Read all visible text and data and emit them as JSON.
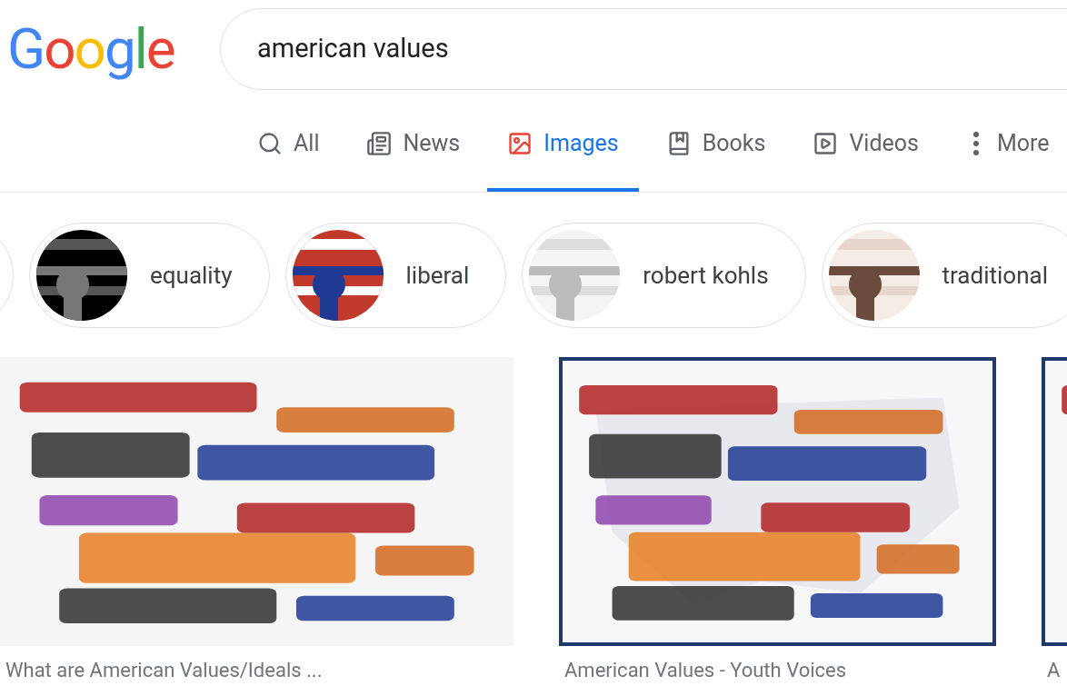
{
  "logo": {
    "text": "Google"
  },
  "search": {
    "value": "american values"
  },
  "tabs": [
    {
      "label": "All",
      "kind": "search",
      "selected": false
    },
    {
      "label": "News",
      "kind": "news",
      "selected": false
    },
    {
      "label": "Images",
      "kind": "images",
      "selected": true
    },
    {
      "label": "Books",
      "kind": "books",
      "selected": false
    },
    {
      "label": "Videos",
      "kind": "videos",
      "selected": false
    },
    {
      "label": "More",
      "kind": "more",
      "selected": false
    }
  ],
  "chips": [
    {
      "label": "equality"
    },
    {
      "label": "liberal"
    },
    {
      "label": "robert kohls"
    },
    {
      "label": "traditional"
    }
  ],
  "results": [
    {
      "caption": "What are American Values/Ideals ...",
      "kind": "plain"
    },
    {
      "caption": "American Values - Youth Voices",
      "kind": "framed"
    },
    {
      "caption": "A",
      "kind": "framed"
    }
  ]
}
